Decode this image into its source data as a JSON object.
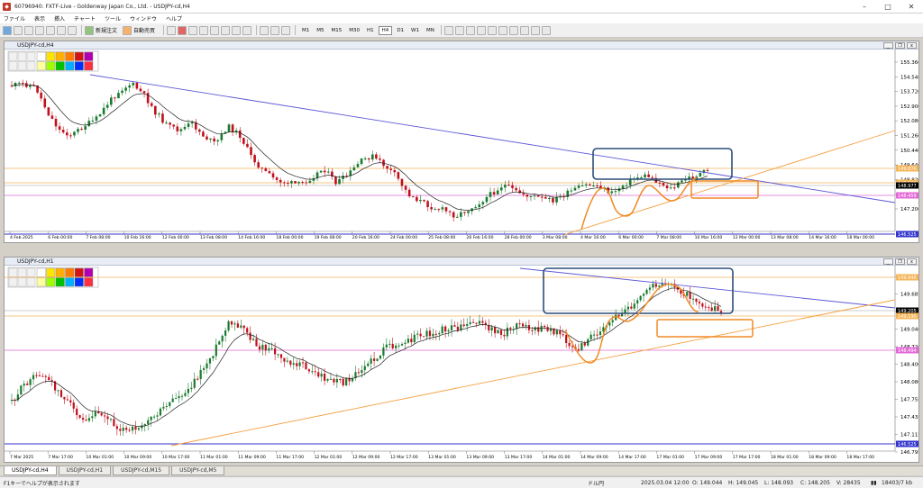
{
  "window": {
    "title": "60796940: FXTF-Live - Goldenway Japan Co., Ltd. - USDJPY-cd,H4"
  },
  "menu": [
    "ファイル",
    "表示",
    "挿入",
    "チャート",
    "ツール",
    "ウィンドウ",
    "ヘルプ"
  ],
  "toolbar": {
    "new_order": "新規注文",
    "auto_trade": "自動売買",
    "timeframes": [
      "M1",
      "M5",
      "M15",
      "M30",
      "H1",
      "H4",
      "D1",
      "W1",
      "MN"
    ],
    "active_timeframe": "H4"
  },
  "charts": {
    "top": {
      "tab_title": "USDJPY-cd,H4",
      "caption": "USDJPY-cd,H4",
      "price_labels": [
        "155.360",
        "154.540",
        "153.720",
        "152.900",
        "152.080",
        "151.260",
        "150.440",
        "149.640",
        "148.820",
        "148.000",
        "147.200"
      ],
      "marked_prices": {
        "orange1": "149.876",
        "orange2": "149.190",
        "current": "148.977",
        "pink": "148.459",
        "blue": "146.525"
      },
      "time_labels": [
        "4 Feb 2025",
        "6 Feb 00:00",
        "7 Feb 08:00",
        "10 Feb 16:00",
        "12 Feb 00:00",
        "13 Feb 08:00",
        "14 Feb 16:00",
        "18 Feb 00:00",
        "19 Feb 08:00",
        "20 Feb 16:00",
        "24 Feb 00:00",
        "25 Feb 08:00",
        "26 Feb 16:00",
        "28 Feb 00:00",
        "3 Mar 08:00",
        "4 Mar 16:00",
        "6 Mar 00:00",
        "7 Mar 08:00",
        "10 Mar 16:00",
        "12 Mar 00:00",
        "13 Mar 08:00",
        "14 Mar 16:00",
        "18 Mar 00:00"
      ]
    },
    "bottom": {
      "tab_title": "USDJPY-cd,H1",
      "caption": "USDJPY-cd,H1",
      "price_labels": [
        "150.010",
        "149.685",
        "149.365",
        "149.040",
        "148.720",
        "148.400",
        "148.080",
        "147.755",
        "147.435",
        "147.115",
        "146.795"
      ],
      "marked_prices": {
        "orange1": "149.945",
        "current": "149.205",
        "orange2": "149.190",
        "pink": "148.494",
        "blue": "146.525"
      },
      "time_labels": [
        "7 Mar 2025",
        "7 Mar 17:00",
        "10 Mar 01:00",
        "10 Mar 09:00",
        "10 Mar 17:00",
        "11 Mar 01:00",
        "11 Mar 09:00",
        "11 Mar 17:00",
        "12 Mar 01:00",
        "12 Mar 09:00",
        "12 Mar 17:00",
        "13 Mar 01:00",
        "13 Mar 09:00",
        "13 Mar 17:00",
        "14 Mar 01:00",
        "14 Mar 09:00",
        "14 Mar 17:00",
        "17 Mar 01:00",
        "17 Mar 09:00",
        "17 Mar 17:00",
        "18 Mar 01:00",
        "18 Mar 09:00",
        "18 Mar 17:00"
      ]
    }
  },
  "tabs": [
    "USDJPY-cd,H4",
    "USDJPY-cd,H1",
    "USDJPY-cd,M15",
    "USDJPY-cd,M5"
  ],
  "active_tab": "USDJPY-cd,H4",
  "status": {
    "help": "F1キーでヘルプが表示されます",
    "profile": "ドル円",
    "datetime": "2025.03.04 12:00",
    "open": "O: 149.044",
    "high": "H: 149.045",
    "low": "L: 148.093",
    "close": "C: 148.205",
    "volume": "V: 28435",
    "traffic": "18403/7 kb"
  },
  "colors": {
    "up": "#1a7a2e",
    "down": "#c0101c",
    "ma": "#222222",
    "trend_blue": "#5b57d6",
    "trend_orange": "#f5a040",
    "level_orange": "#f5b55a",
    "level_pink": "#e36ad6",
    "level_blue": "#3333cc",
    "box_blue": "#2d4d7a",
    "box_orange": "#f08a24"
  }
}
